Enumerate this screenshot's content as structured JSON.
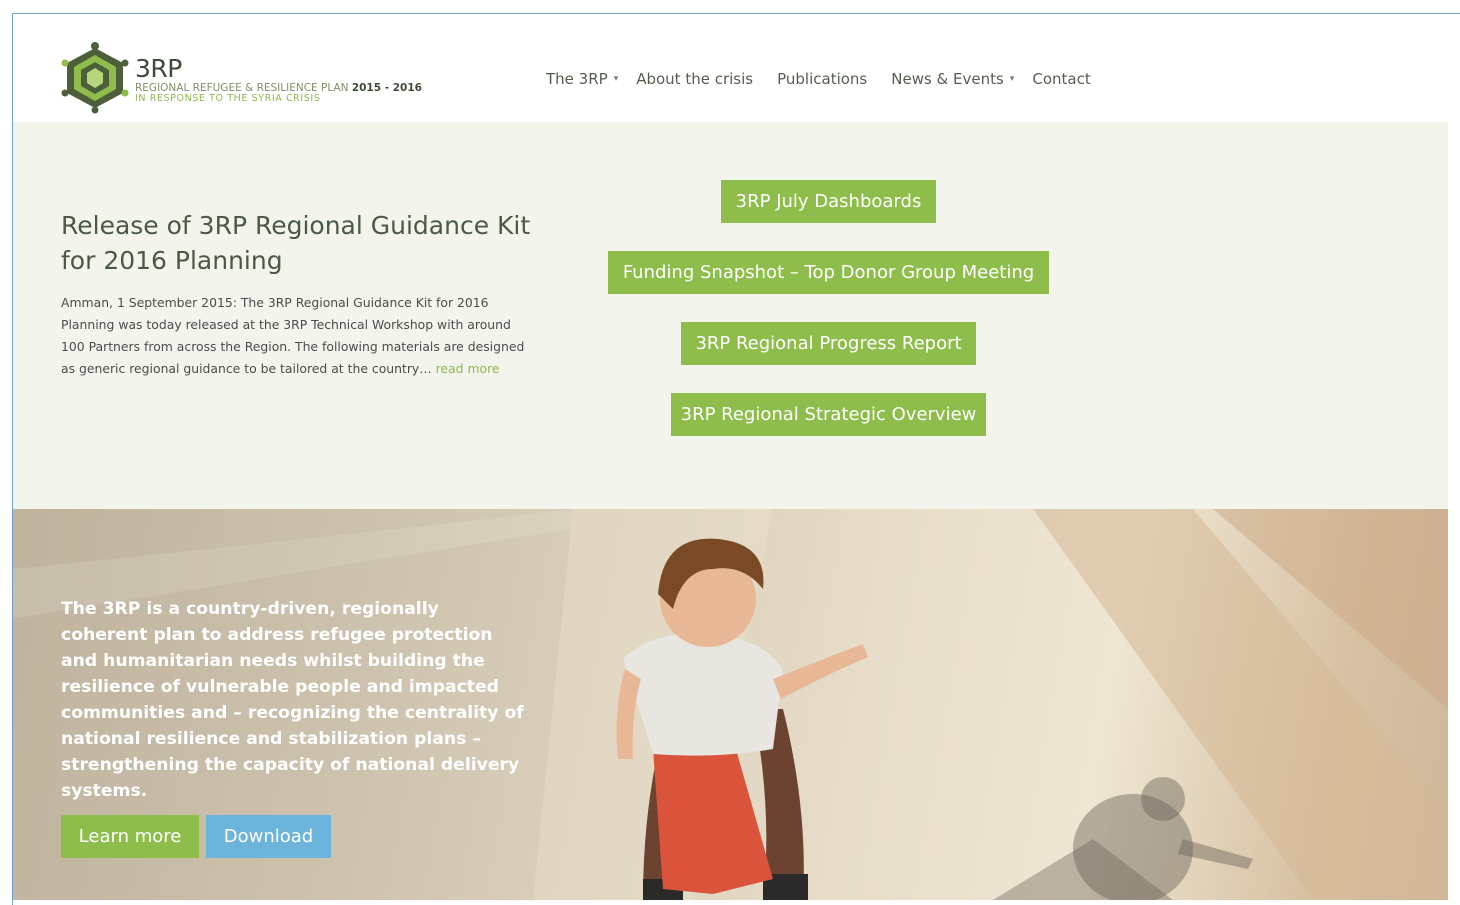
{
  "header": {
    "logo": {
      "title": "3RP",
      "subtitle": "REGIONAL REFUGEE & RESILIENCE PLAN",
      "years": "2015 - 2016",
      "tagline": "IN RESPONSE TO THE SYRIA CRISIS",
      "icon": "3rp-logo-icon"
    },
    "nav": [
      {
        "label": "The 3RP",
        "caret": "▾"
      },
      {
        "label": "About the crisis"
      },
      {
        "label": "Publications"
      },
      {
        "label": "News & Events",
        "caret": "▾"
      },
      {
        "label": "Contact"
      }
    ]
  },
  "hero": {
    "news": {
      "title": "Release of 3RP Regional Guidance Kit for 2016 Planning",
      "body": "Amman, 1 September 2015: The 3RP Regional Guidance Kit for 2016 Planning was today released at the 3RP Technical Workshop with around 100 Partners from across the Region. The following materials are designed as generic regional guidance to be tailored at the country…",
      "read_more": "read more"
    },
    "ctas": [
      "3RP July Dashboards",
      "Funding Snapshot – Top Donor Group Meeting",
      "3RP Regional Progress Report",
      "3RP Regional Strategic Overview"
    ]
  },
  "banner": {
    "text": "The 3RP is a country-driven, regionally coherent plan to address refugee protection and humanitarian needs whilst building the resilience of vulnerable people and impacted communities and – recognizing the centrality of national resilience and stabilization plans – strengthening the capacity of national delivery systems.",
    "learn_more": "Learn more",
    "download": "Download"
  },
  "colors": {
    "accent_green": "#8fbd4c",
    "download_blue": "#6cb4dc",
    "hero_bg": "#f3f5ec"
  }
}
